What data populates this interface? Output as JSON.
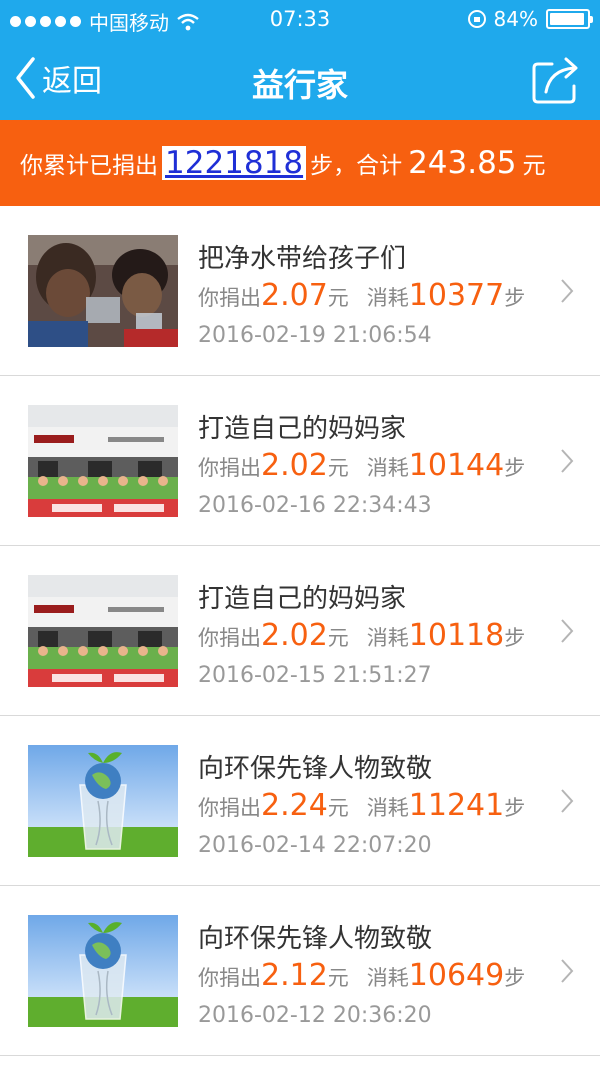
{
  "status_bar": {
    "carrier": "中国移动",
    "time": "07:33",
    "battery": "84%"
  },
  "nav": {
    "back_label": "返回",
    "title": "益行家"
  },
  "summary": {
    "prefix": "你累计已捐出",
    "steps": "1221818",
    "steps_unit": "步，合计",
    "amount": "243.85",
    "amount_unit": "元"
  },
  "labels": {
    "donated": "你捐出",
    "currency": "元",
    "consumed": "消耗",
    "step_unit": "步"
  },
  "items": [
    {
      "title": "把净水带给孩子们",
      "amount": "2.07",
      "steps": "10377",
      "date": "2016-02-19 21:06:54",
      "image": "children-drinking-water"
    },
    {
      "title": "打造自己的妈妈家",
      "amount": "2.02",
      "steps": "10144",
      "date": "2016-02-16 22:34:43",
      "image": "mama-home-group-photo"
    },
    {
      "title": "打造自己的妈妈家",
      "amount": "2.02",
      "steps": "10118",
      "date": "2016-02-15 21:51:27",
      "image": "mama-home-group-photo"
    },
    {
      "title": "向环保先锋人物致敬",
      "amount": "2.24",
      "steps": "11241",
      "date": "2016-02-14 22:07:20",
      "image": "plant-globe-glass"
    },
    {
      "title": "向环保先锋人物致敬",
      "amount": "2.12",
      "steps": "10649",
      "date": "2016-02-12 20:36:20",
      "image": "plant-globe-glass"
    }
  ],
  "colors": {
    "header_blue": "#1fa9ec",
    "accent_orange": "#f76010",
    "link_blue": "#1f2fd6"
  }
}
